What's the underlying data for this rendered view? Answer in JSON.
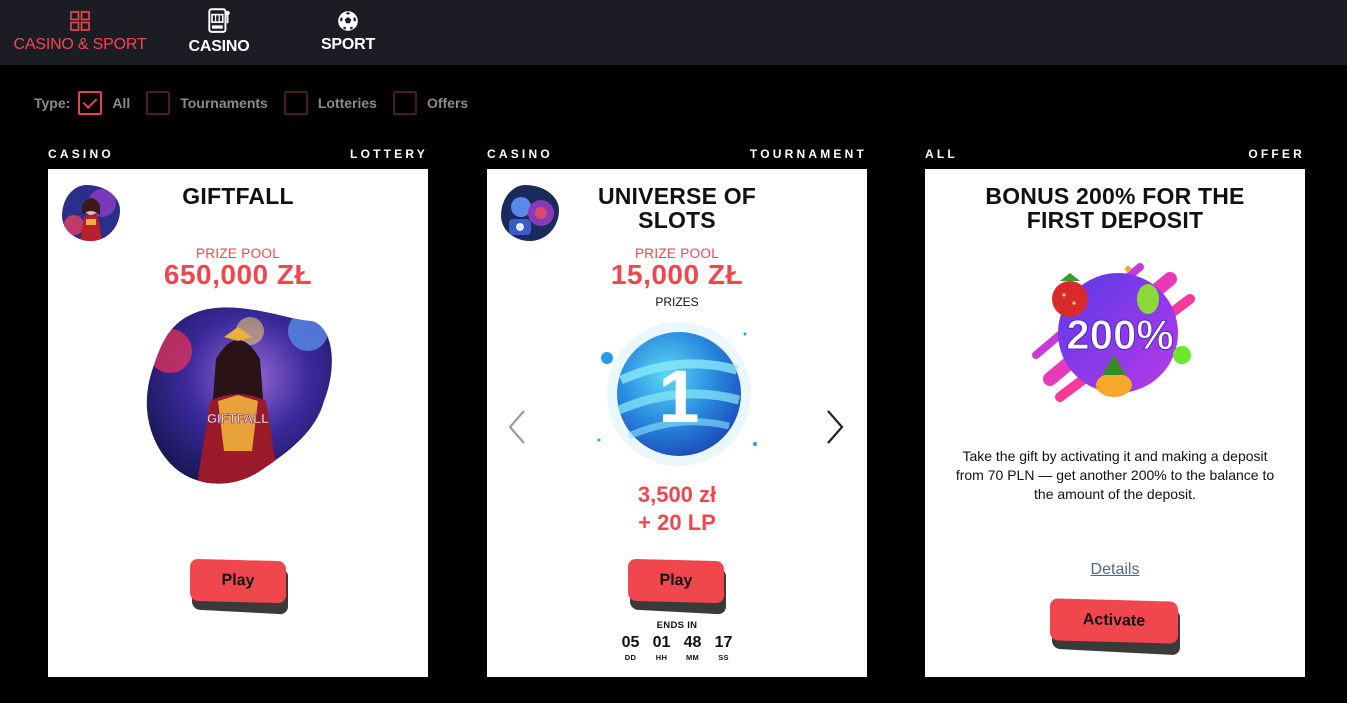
{
  "nav": {
    "tabs": [
      {
        "label": "CASINO & SPORT",
        "icon": "grid-icon",
        "active": true
      },
      {
        "label": "CASINO",
        "icon": "slot-machine-icon",
        "active": false
      },
      {
        "label": "SPORT",
        "icon": "soccer-ball-icon",
        "active": false
      }
    ]
  },
  "filters": {
    "type_label": "Type:",
    "options": [
      {
        "label": "All",
        "checked": true
      },
      {
        "label": "Tournaments",
        "checked": false
      },
      {
        "label": "Lotteries",
        "checked": false
      },
      {
        "label": "Offers",
        "checked": false
      }
    ]
  },
  "cards": [
    {
      "category": "CASINO",
      "kind": "LOTTERY",
      "title": "GIFTFALL",
      "prize_pool_label": "PRIZE POOL",
      "prize_pool_value": "650,000 ZŁ",
      "art_text": "GIFTFALL",
      "button": "Play"
    },
    {
      "category": "CASINO",
      "kind": "TOURNAMENT",
      "title_line1": "UNIVERSE OF",
      "title_line2": "SLOTS",
      "prize_pool_label": "PRIZE POOL",
      "prize_pool_value": "15,000 ZŁ",
      "prizes_label": "PRIZES",
      "place": "1",
      "reward_line1": "3,500 zł",
      "reward_line2": "+ 20 LP",
      "button": "Play",
      "countdown": {
        "title": "ENDS IN",
        "cells": [
          {
            "value": "05",
            "unit": "DD"
          },
          {
            "value": "01",
            "unit": "HH"
          },
          {
            "value": "48",
            "unit": "MM"
          },
          {
            "value": "17",
            "unit": "SS"
          }
        ]
      }
    },
    {
      "category": "ALL",
      "kind": "OFFER",
      "title_line1": "BONUS 200% FOR THE",
      "title_line2": "FIRST DEPOSIT",
      "art_text": "200%",
      "description": "Take the gift by activating it and making a deposit from 70 PLN — get another 200% to the balance to the amount of the deposit.",
      "details_link": "Details",
      "button": "Activate"
    }
  ],
  "colors": {
    "accent": "#f0474f",
    "nav_bg": "#1c1d24",
    "page_bg": "#000000",
    "card_bg": "#ffffff"
  }
}
